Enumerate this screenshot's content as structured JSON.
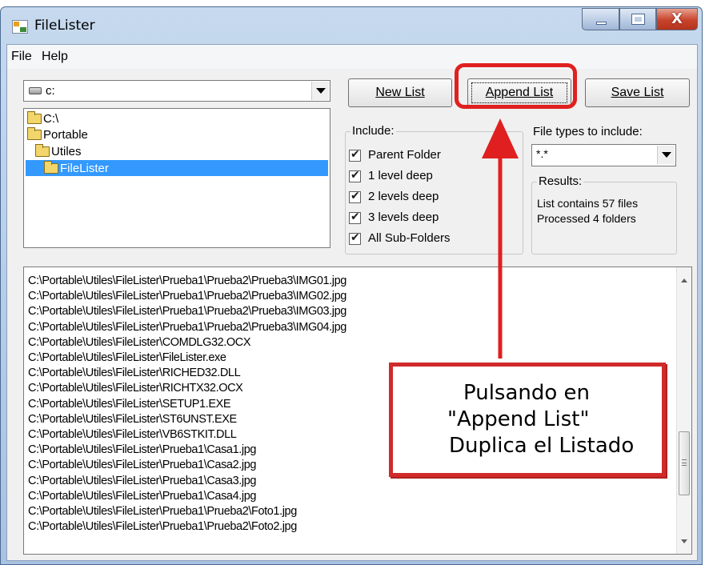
{
  "window": {
    "title": "FileLister"
  },
  "title_controls": {
    "minimize": "–",
    "maximize": "□",
    "close": "X"
  },
  "menu": {
    "items": [
      {
        "label": "File"
      },
      {
        "label": "Help"
      }
    ]
  },
  "drive": {
    "value": "c:",
    "icon": "drive-icon"
  },
  "tree": {
    "items": [
      {
        "label": "C:\\"
      },
      {
        "label": "Portable"
      },
      {
        "label": "Utiles"
      },
      {
        "label": "FileLister",
        "selected": true
      }
    ]
  },
  "buttons": {
    "new_list": "New List",
    "append_list": "Append List",
    "save_list": "Save List"
  },
  "include": {
    "title": "Include:",
    "options": [
      {
        "label": "Parent Folder",
        "checked": true
      },
      {
        "label": "1 level deep",
        "checked": true
      },
      {
        "label": "2 levels deep",
        "checked": true
      },
      {
        "label": "3 levels deep",
        "checked": true
      },
      {
        "label": "All Sub-Folders",
        "checked": true
      }
    ]
  },
  "file_types": {
    "label": "File types to include:",
    "value": "*.*"
  },
  "results": {
    "title": "Results:",
    "lines": [
      "List contains 57 files",
      "Processed 4 folders"
    ]
  },
  "file_list": [
    "C:\\Portable\\Utiles\\FileLister\\Prueba1\\Prueba2\\Prueba3\\IMG01.jpg",
    "C:\\Portable\\Utiles\\FileLister\\Prueba1\\Prueba2\\Prueba3\\IMG02.jpg",
    "C:\\Portable\\Utiles\\FileLister\\Prueba1\\Prueba2\\Prueba3\\IMG03.jpg",
    "C:\\Portable\\Utiles\\FileLister\\Prueba1\\Prueba2\\Prueba3\\IMG04.jpg",
    "C:\\Portable\\Utiles\\FileLister\\COMDLG32.OCX",
    "C:\\Portable\\Utiles\\FileLister\\FileLister.exe",
    "C:\\Portable\\Utiles\\FileLister\\RICHED32.DLL",
    "C:\\Portable\\Utiles\\FileLister\\RICHTX32.OCX",
    "C:\\Portable\\Utiles\\FileLister\\SETUP1.EXE",
    "C:\\Portable\\Utiles\\FileLister\\ST6UNST.EXE",
    "C:\\Portable\\Utiles\\FileLister\\VB6STKIT.DLL",
    "C:\\Portable\\Utiles\\FileLister\\Prueba1\\Casa1.jpg",
    "C:\\Portable\\Utiles\\FileLister\\Prueba1\\Casa2.jpg",
    "C:\\Portable\\Utiles\\FileLister\\Prueba1\\Casa3.jpg",
    "C:\\Portable\\Utiles\\FileLister\\Prueba1\\Casa4.jpg",
    "C:\\Portable\\Utiles\\FileLister\\Prueba1\\Prueba2\\Foto1.jpg",
    "C:\\Portable\\Utiles\\FileLister\\Prueba1\\Prueba2\\Foto2.jpg"
  ],
  "callout": {
    "lines": [
      "Pulsando en",
      "\"Append List\"",
      "Duplica el Listado"
    ]
  },
  "colors": {
    "highlight": "#e02020",
    "selection": "#3399ff"
  }
}
